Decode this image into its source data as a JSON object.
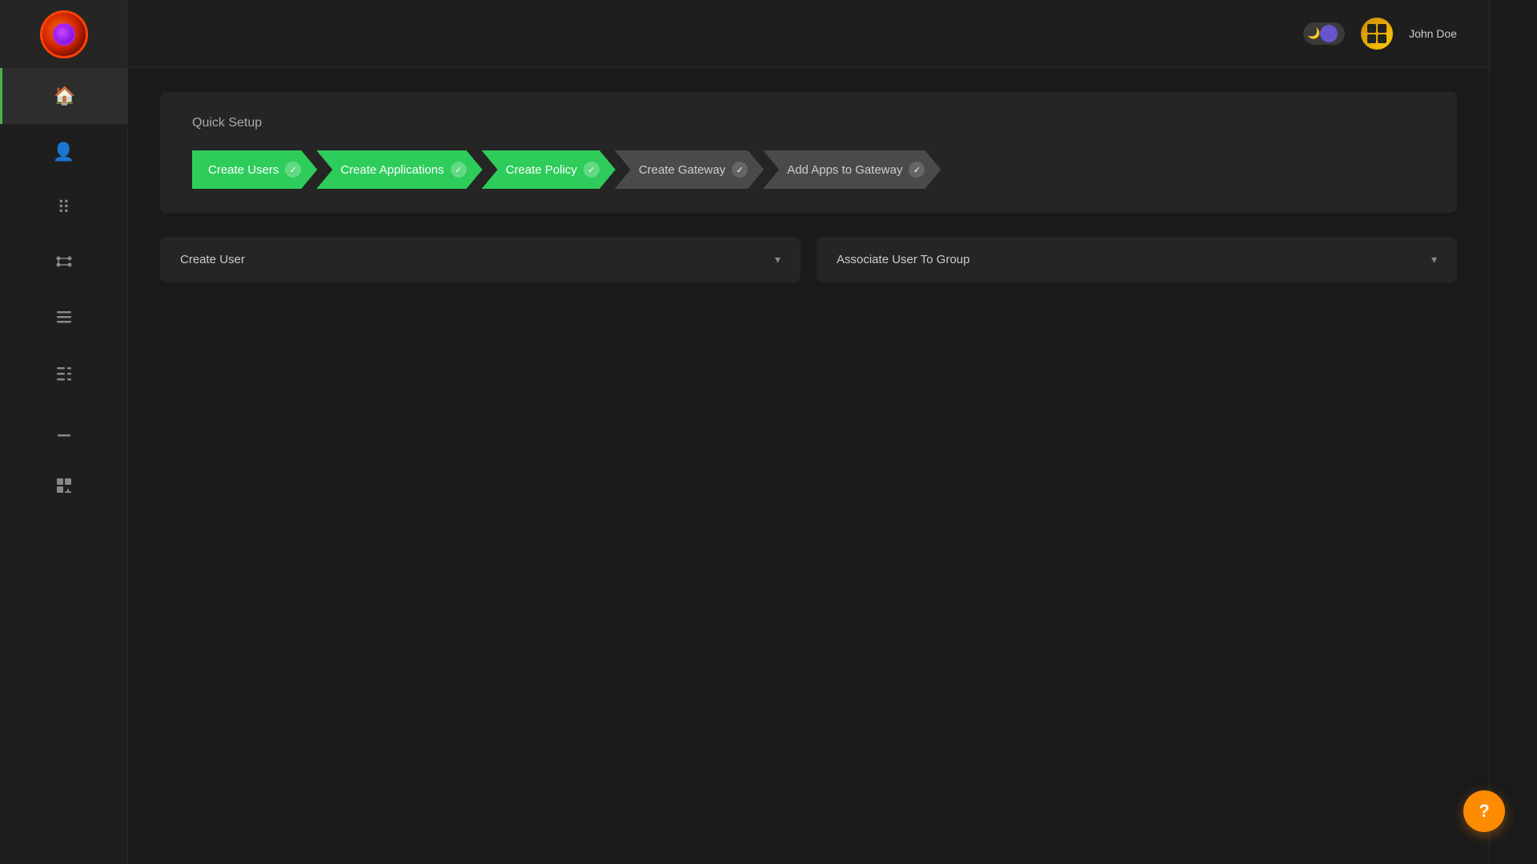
{
  "sidebar": {
    "items": [
      {
        "id": "home",
        "icon": "⌂",
        "active": true
      },
      {
        "id": "users",
        "icon": "👥"
      },
      {
        "id": "apps",
        "icon": "⠿"
      },
      {
        "id": "integrations",
        "icon": "⚙"
      },
      {
        "id": "logs",
        "icon": "☰"
      },
      {
        "id": "settings",
        "icon": "⚙"
      },
      {
        "id": "download",
        "icon": "↓"
      },
      {
        "id": "widgets",
        "icon": "⊞"
      }
    ]
  },
  "header": {
    "user_name": "John Doe"
  },
  "quick_setup": {
    "title": "Quick Setup",
    "steps": [
      {
        "id": "create-users",
        "label": "Create Users",
        "status": "green",
        "checked": true
      },
      {
        "id": "create-applications",
        "label": "Create Applications",
        "status": "green",
        "checked": true
      },
      {
        "id": "create-policy",
        "label": "Create Policy",
        "status": "green",
        "checked": true
      },
      {
        "id": "create-gateway",
        "label": "Create Gateway",
        "status": "gray",
        "checked": true
      },
      {
        "id": "add-apps-to-gateway",
        "label": "Add Apps to Gateway",
        "status": "gray",
        "checked": true
      }
    ]
  },
  "panels": {
    "create_user": {
      "title": "Create User",
      "chevron": "▾"
    },
    "associate_user": {
      "title": "Associate User To Group",
      "chevron": "▾"
    }
  },
  "help": {
    "label": "?"
  }
}
